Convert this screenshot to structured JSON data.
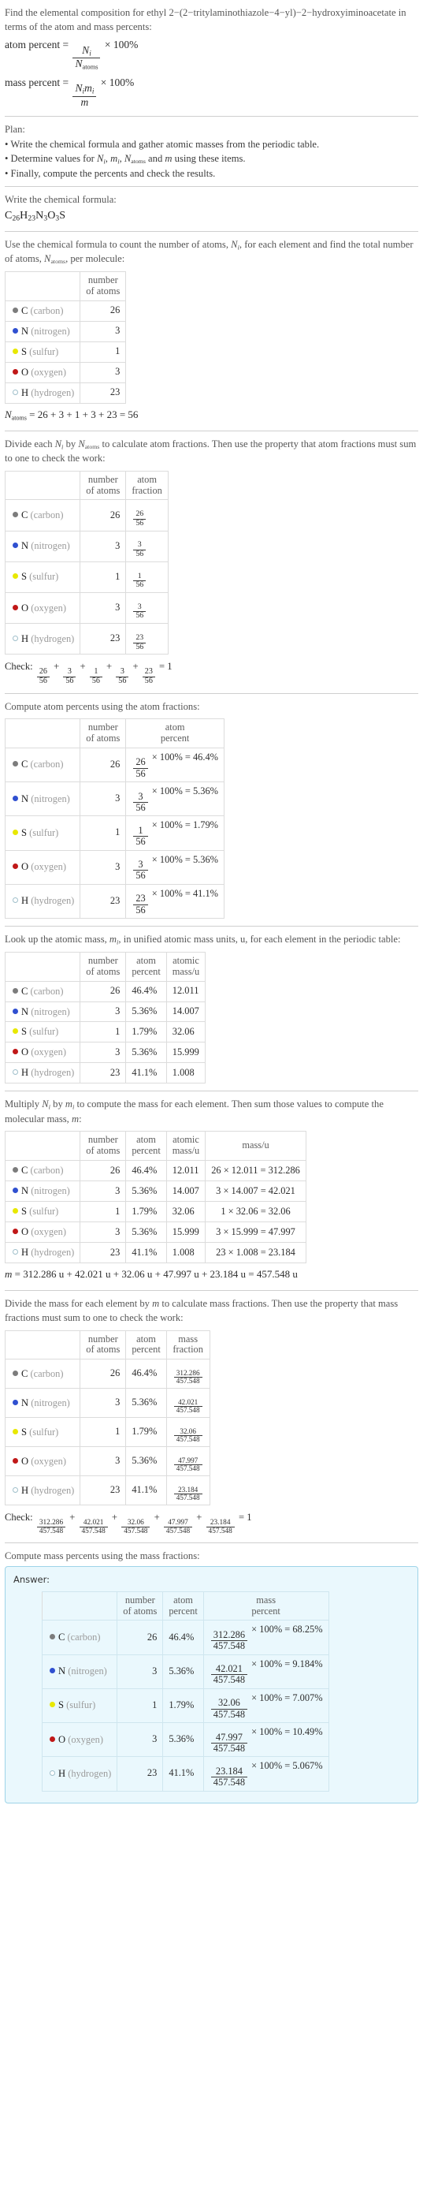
{
  "intro": {
    "question": "Find the elemental composition for ethyl 2−(2−tritylaminothiazole−4−yl)−2−hydroxyiminoacetate in terms of the atom and mass percents:",
    "atom_percent_label": "atom percent",
    "mass_percent_label": "mass percent",
    "atom_percent_num": "N",
    "atom_percent_num_sub": "i",
    "atom_percent_den": "N",
    "atom_percent_den_sub": "atoms",
    "mass_percent_num": "N",
    "mass_percent_num_sub": "i",
    "mass_percent_num2": "m",
    "mass_percent_num2_sub": "i",
    "mass_percent_den": "m",
    "times100": "× 100%",
    "equals": "="
  },
  "plan": {
    "heading": "Plan:",
    "items": [
      "• Write the chemical formula and gather atomic masses from the periodic table.",
      "• Finally, compute the percents and check the results."
    ],
    "item2_pre": "• Determine values for ",
    "item2_mid": " and ",
    "item2_post": " using these items."
  },
  "formula_step": {
    "prompt": "Write the chemical formula:",
    "formula_parts": [
      {
        "sym": "C",
        "sub": "26"
      },
      {
        "sym": "H",
        "sub": "23"
      },
      {
        "sym": "N",
        "sub": "3"
      },
      {
        "sym": "O",
        "sub": "3"
      },
      {
        "sym": "S",
        "sub": ""
      }
    ]
  },
  "count_step": {
    "prompt_a": "Use the chemical formula to count the number of atoms, ",
    "prompt_b": ", for each element and find the total number of atoms, ",
    "prompt_c": ", per molecule:",
    "headers": [
      "",
      "number of atoms"
    ],
    "total_line": "= 26 + 3 + 1 + 3 + 23 = 56"
  },
  "elements": [
    {
      "symbol": "C",
      "name": "(carbon)",
      "color": "#7c7c7c",
      "filled": true,
      "count": "26",
      "atom_fraction_num": "26",
      "atom_fraction_den": "56",
      "atom_percent": "46.4%",
      "atomic_mass": "12.011",
      "mass_expr": "26 × 12.011 = 312.286",
      "mass_num": "312.286",
      "mass_den": "457.548",
      "mass_percent": "68.25%"
    },
    {
      "symbol": "N",
      "name": "(nitrogen)",
      "color": "#3050d0",
      "filled": true,
      "count": "3",
      "atom_fraction_num": "3",
      "atom_fraction_den": "56",
      "atom_percent": "5.36%",
      "atomic_mass": "14.007",
      "mass_expr": "3 × 14.007 = 42.021",
      "mass_num": "42.021",
      "mass_den": "457.548",
      "mass_percent": "9.184%"
    },
    {
      "symbol": "S",
      "name": "(sulfur)",
      "color": "#e8e800",
      "filled": true,
      "count": "1",
      "atom_fraction_num": "1",
      "atom_fraction_den": "56",
      "atom_percent": "1.79%",
      "atomic_mass": "32.06",
      "mass_expr": "1 × 32.06 = 32.06",
      "mass_num": "32.06",
      "mass_den": "457.548",
      "mass_percent": "7.007%"
    },
    {
      "symbol": "O",
      "name": "(oxygen)",
      "color": "#c01818",
      "filled": true,
      "count": "3",
      "atom_fraction_num": "3",
      "atom_fraction_den": "56",
      "atom_percent": "5.36%",
      "atomic_mass": "15.999",
      "mass_expr": "3 × 15.999 = 47.997",
      "mass_num": "47.997",
      "mass_den": "457.548",
      "mass_percent": "10.49%"
    },
    {
      "symbol": "H",
      "name": "(hydrogen)",
      "color": "#e8f4f8",
      "filled": false,
      "count": "23",
      "atom_fraction_num": "23",
      "atom_fraction_den": "56",
      "atom_percent": "41.1%",
      "atomic_mass": "1.008",
      "mass_expr": "23 × 1.008 = 23.184",
      "mass_num": "23.184",
      "mass_den": "457.548",
      "mass_percent": "5.067%"
    }
  ],
  "atom_fraction_step": {
    "prompt_a": "Divide each ",
    "prompt_b": " by ",
    "prompt_c": " to calculate atom fractions. Then use the property that atom fractions must sum to one to check the work:",
    "headers": [
      "",
      "number of atoms",
      "atom fraction"
    ],
    "check_label": "Check:",
    "check_result": "= 1"
  },
  "atom_percent_step": {
    "prompt": "Compute atom percents using the atom fractions:",
    "headers": [
      "",
      "number of atoms",
      "atom percent"
    ],
    "times100": "× 100% ="
  },
  "atomic_mass_step": {
    "prompt_a": "Look up the atomic mass, ",
    "prompt_b": ", in unified atomic mass units, u, for each element in the periodic table:",
    "headers": [
      "",
      "number of atoms",
      "atom percent",
      "atomic mass/u"
    ]
  },
  "mass_step": {
    "prompt_a": "Multiply ",
    "prompt_b": " by ",
    "prompt_c": " to compute the mass for each element. Then sum those values to compute the molecular mass, ",
    "prompt_d": ":",
    "headers": [
      "",
      "number of atoms",
      "atom percent",
      "atomic mass/u",
      "mass/u"
    ],
    "total_line": "= 312.286 u + 42.021 u + 32.06 u + 47.997 u + 23.184 u = 457.548 u"
  },
  "mass_fraction_step": {
    "prompt_a": "Divide the mass for each element by ",
    "prompt_b": " to calculate mass fractions. Then use the property that mass fractions must sum to one to check the work:",
    "headers": [
      "",
      "number of atoms",
      "atom percent",
      "mass fraction"
    ],
    "check_label": "Check:",
    "check_result": "= 1"
  },
  "mass_percent_step": {
    "prompt": "Compute mass percents using the mass fractions:",
    "answer_label": "Answer:",
    "headers": [
      "",
      "number of atoms",
      "atom percent",
      "mass percent"
    ],
    "times100": "× 100% ="
  },
  "symbols": {
    "N": "N",
    "m": "m",
    "sub_i": "i",
    "sub_atoms": "atoms",
    "plus": "+",
    "times": "×"
  },
  "colors": {
    "answer_bg": "#eaf8fd",
    "answer_border": "#9ed4e8",
    "rule": "#cfcfcf",
    "text": "#3b3b3b",
    "muted": "#9b9b9b"
  }
}
